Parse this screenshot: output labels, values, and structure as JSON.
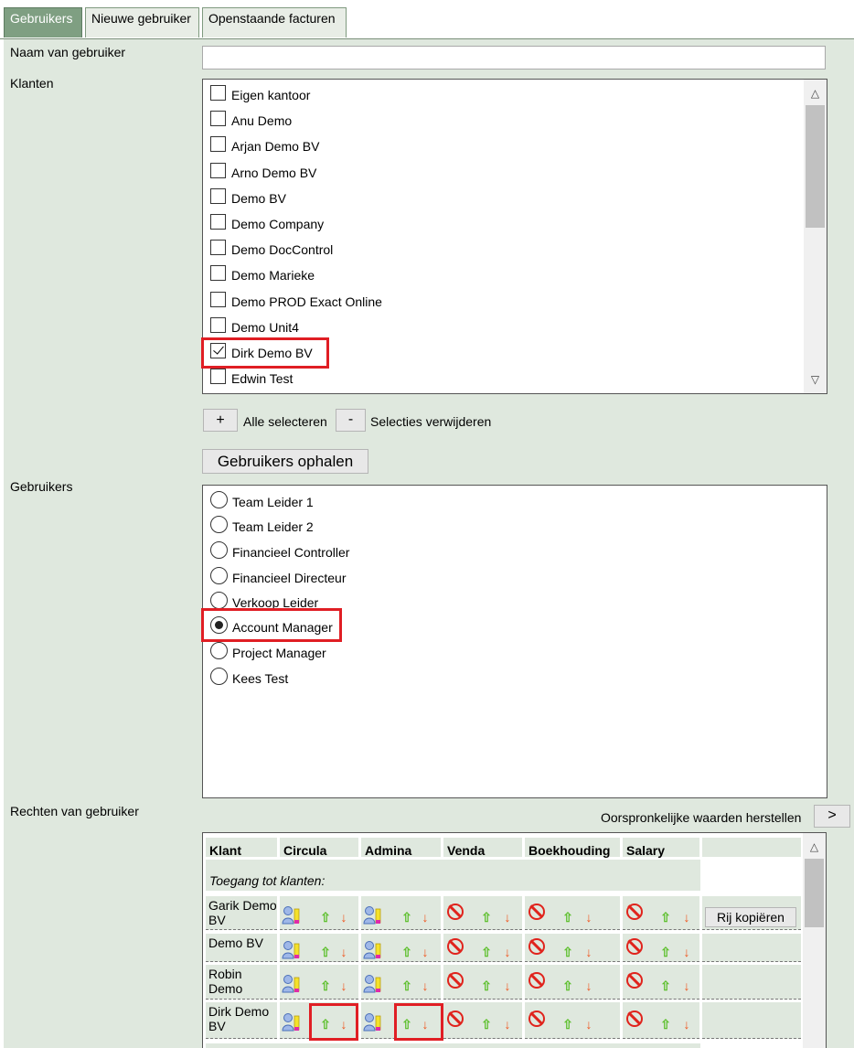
{
  "tabs": [
    {
      "label": "Gebruikers",
      "active": true
    },
    {
      "label": "Nieuwe gebruiker",
      "active": false
    },
    {
      "label": "Openstaande facturen",
      "active": false
    }
  ],
  "form": {
    "name_label": "Naam van gebruiker",
    "name_value": "",
    "clients_label": "Klanten",
    "users_label": "Gebruikers",
    "rights_label": "Rechten van gebruiker"
  },
  "clients": [
    {
      "label": "Eigen kantoor",
      "checked": false
    },
    {
      "label": "Anu Demo",
      "checked": false
    },
    {
      "label": "Arjan Demo BV",
      "checked": false
    },
    {
      "label": "Arno Demo BV",
      "checked": false
    },
    {
      "label": "Demo BV",
      "checked": false
    },
    {
      "label": "Demo Company",
      "checked": false
    },
    {
      "label": "Demo DocControl",
      "checked": false
    },
    {
      "label": "Demo Marieke",
      "checked": false
    },
    {
      "label": "Demo PROD Exact Online",
      "checked": false
    },
    {
      "label": "Demo Unit4",
      "checked": false
    },
    {
      "label": "Dirk Demo BV",
      "checked": true
    },
    {
      "label": "Edwin Test",
      "checked": false
    }
  ],
  "select_controls": {
    "select_all_symbol": "+",
    "select_all_label": "Alle selecteren",
    "clear_symbol": "-",
    "clear_label": "Selecties verwijderen",
    "fetch_users_label": "Gebruikers ophalen"
  },
  "users": [
    {
      "label": "Team Leider 1",
      "selected": false
    },
    {
      "label": "Team Leider 2",
      "selected": false
    },
    {
      "label": "Financieel Controller",
      "selected": false
    },
    {
      "label": "Financieel Directeur",
      "selected": false
    },
    {
      "label": "Verkoop Leider",
      "selected": false
    },
    {
      "label": "Account Manager",
      "selected": true
    },
    {
      "label": "Project Manager",
      "selected": false
    },
    {
      "label": "Kees Test",
      "selected": false
    }
  ],
  "rights": {
    "restore_label": "Oorspronkelijke waarden herstellen",
    "restore_button": ">",
    "columns": [
      "Klant",
      "Circula",
      "Admina",
      "Venda",
      "Boekhouding",
      "Salary"
    ],
    "section_label": "Toegang tot klanten:",
    "copy_row_label": "Rij kopiëren",
    "rows": [
      {
        "client": "Garik Demo BV",
        "access": [
          "user",
          "user",
          "blocked",
          "blocked",
          "blocked"
        ]
      },
      {
        "client": "Demo BV",
        "access": [
          "user",
          "user",
          "blocked",
          "blocked",
          "blocked"
        ]
      },
      {
        "client": "Robin Demo",
        "access": [
          "user",
          "user",
          "blocked",
          "blocked",
          "blocked"
        ]
      },
      {
        "client": "Dirk Demo BV",
        "access": [
          "user",
          "user",
          "blocked",
          "blocked",
          "blocked"
        ]
      }
    ]
  },
  "colors": {
    "panel_bg": "#dfe8de",
    "active_tab": "#7f9f82",
    "highlight": "#e01e24",
    "arrow_up": "#5fc02f",
    "arrow_down": "#f0561f",
    "blocked": "#e0231c"
  }
}
